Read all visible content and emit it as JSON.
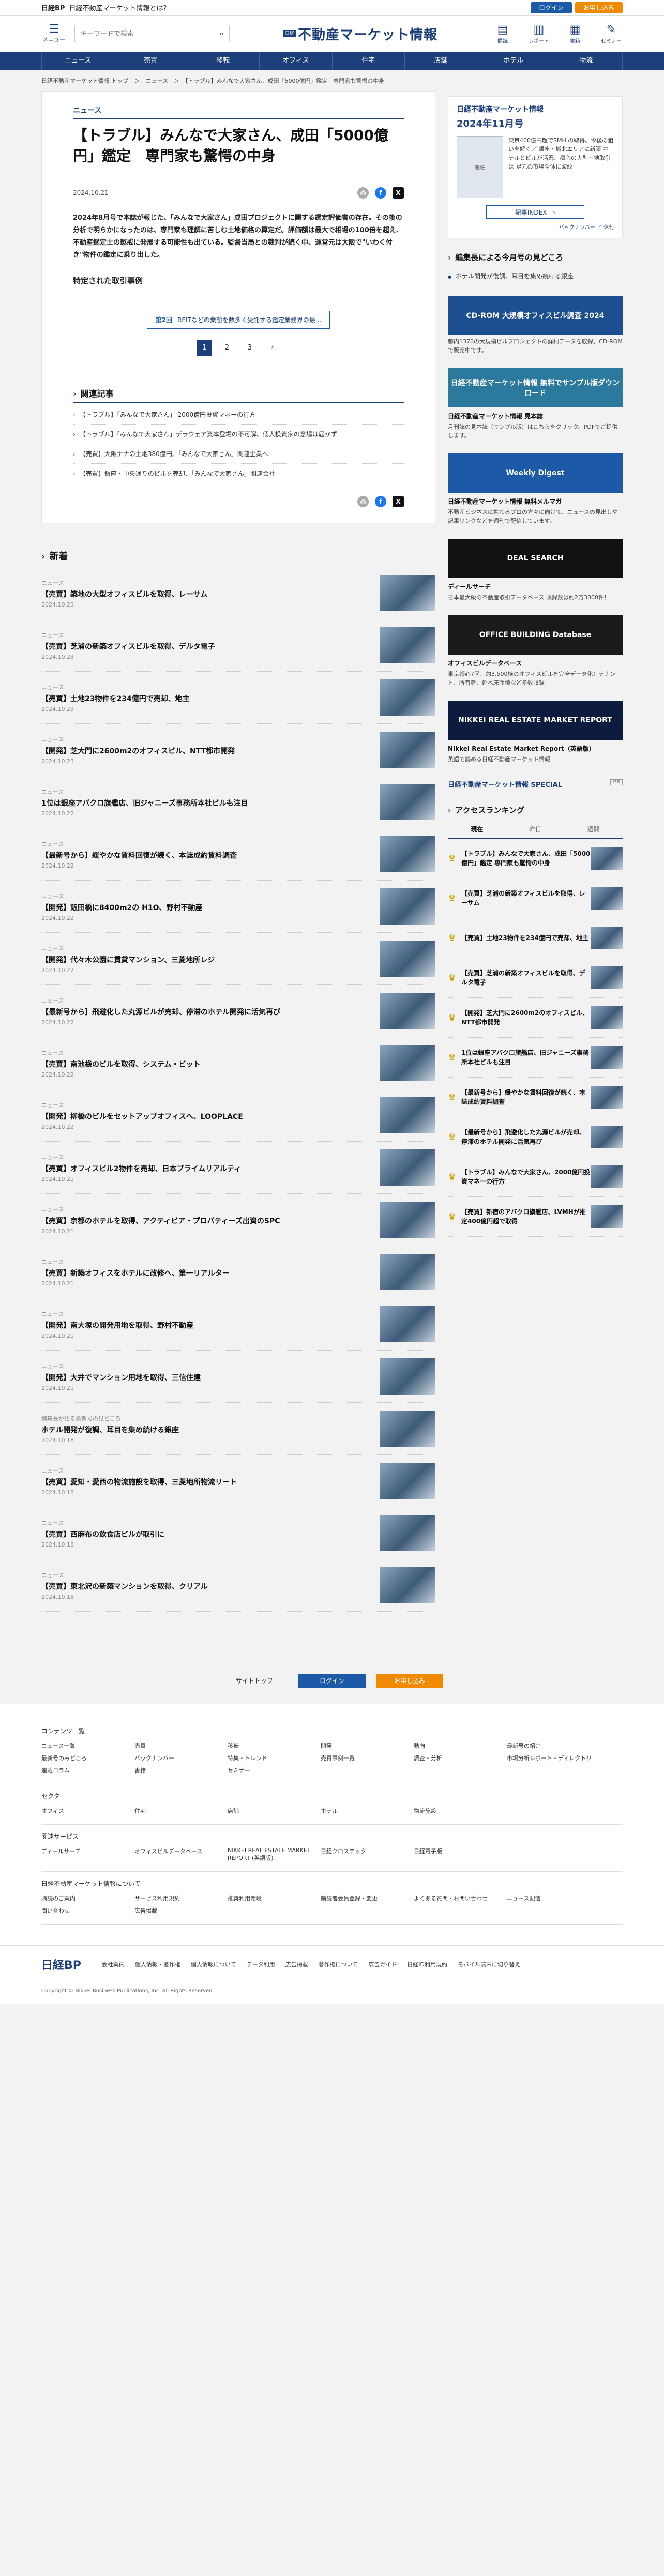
{
  "topbar": {
    "brand": "日経BP",
    "tagline": "日経不動産マーケット情報とは？",
    "login": "ログイン",
    "trial": "お申し込み"
  },
  "header": {
    "menu_label": "メニュー",
    "search_placeholder": "キーワードで検索",
    "logo_nikkei": "日経",
    "logo_title": "不動産マーケット情報",
    "icons": [
      {
        "label": "購読",
        "icon": "book-icon"
      },
      {
        "label": "レポート",
        "icon": "report-icon"
      },
      {
        "label": "書籍",
        "icon": "books-icon"
      },
      {
        "label": "セミナー",
        "icon": "seminar-icon"
      }
    ]
  },
  "nav": [
    "ニュース",
    "売買",
    "移転",
    "オフィス",
    "住宅",
    "店舗",
    "ホテル",
    "物流"
  ],
  "breadcrumb": "日経不動産マーケット情報 トップ　＞　ニュース　＞　【トラブル】みんなで大家さん、成田「5000億円」鑑定　専門家も驚愕の中身",
  "article": {
    "category": "ニュース",
    "title": "【トラブル】みんなで大家さん、成田「5000億円」鑑定　専門家も驚愕の中身",
    "date": "2024.10.21",
    "lead": "2024年8月号で本誌が報じた、「みんなで大家さん」成田プロジェクトに関する鑑定評価書の存在。その後の分析で明らかになったのは、専門家も理解に苦しむ土地価格の算定だ。評価額は最大で相場の100倍を超え、不動産鑑定士の懲戒に発展する可能性も出ている。監督当局との裁判が続く中、運営元は大阪で\"いわく付き\"物件の鑑定に乗り出した。",
    "sub_heading": "特定された取引事例",
    "ad_tag": "第2回",
    "ad_text": "REITなどの業態を数多く受託する鑑定業務界の最...",
    "pages": [
      "1",
      "2",
      "3",
      "›"
    ]
  },
  "related": {
    "heading": "関連記事",
    "items": [
      "【トラブル】「みんなで大家さん」 2000億円投資マネーの行方",
      "【トラブル】「みんなで大家さん」デラウェア資本登場の不可解、個人投資家の意場は届かず",
      "【売買】大阪ナナの土地380億円、「みんなで大家さん」関連企業へ",
      "【売買】銀座・中央通りのビルを売却、「みんなで大家さん」関連会社"
    ]
  },
  "newest": {
    "heading": "新着",
    "items": [
      {
        "cat": "ニュース",
        "title": "【売買】築地の大型オフィスビルを取得、レーサム",
        "date": "2024.10.23"
      },
      {
        "cat": "ニュース",
        "title": "【売買】芝浦の新築オフィスビルを取得、デルタ電子",
        "date": "2024.10.23"
      },
      {
        "cat": "ニュース",
        "title": "【売買】土地23物件を234億円で売却、地主",
        "date": "2024.10.23"
      },
      {
        "cat": "ニュース",
        "title": "【開発】芝大門に2600m2のオフィスビル、NTT都市開発",
        "date": "2024.10.23"
      },
      {
        "cat": "ニュース",
        "title": "1位は銀座アバクロ旗艦店、旧ジャニーズ事務所本社ビルも注目",
        "date": "2024.10.22"
      },
      {
        "cat": "ニュース",
        "title": "【最新号から】緩やかな賃料回復が続く、本誌成約賃料調査",
        "date": "2024.10.22"
      },
      {
        "cat": "ニュース",
        "title": "【開発】飯田橋に8400m2の H1O、野村不動産",
        "date": "2024.10.22"
      },
      {
        "cat": "ニュース",
        "title": "【開発】代々木公園に賃貸マンション、三菱地所レジ",
        "date": "2024.10.22"
      },
      {
        "cat": "ニュース",
        "title": "【最新号から】飛避化した丸源ビルが売却、停滞のホテル開発に活気再び",
        "date": "2024.10.22"
      },
      {
        "cat": "ニュース",
        "title": "【売買】南池袋のビルを取得、システム・ビット",
        "date": "2024.10.22"
      },
      {
        "cat": "ニュース",
        "title": "【開発】柳橋のビルをセットアップオフィスへ、LOOPLACE",
        "date": "2024.10.22"
      },
      {
        "cat": "ニュース",
        "title": "【売買】オフィスビル2物件を売却、日本プライムリアルティ",
        "date": "2024.10.21"
      },
      {
        "cat": "ニュース",
        "title": "【売買】京都のホテルを取得、アクティビア・プロパティーズ出資のSPC",
        "date": "2024.10.21"
      },
      {
        "cat": "ニュース",
        "title": "【売買】新築オフィスをホテルに改修へ、第一リアルター",
        "date": "2024.10.21"
      },
      {
        "cat": "ニュース",
        "title": "【開発】南大塚の開発用地を取得、野村不動産",
        "date": "2024.10.21"
      },
      {
        "cat": "ニュース",
        "title": "【開発】大井でマンション用地を取得、三信住建",
        "date": "2024.10.21"
      },
      {
        "cat": "編集長が語る最新号の見どころ",
        "title": "ホテル開発が復調、耳目を集め続ける銀座",
        "date": "2024.10.18"
      },
      {
        "cat": "ニュース",
        "title": "【売買】愛知・愛西の物流施設を取得、三菱地所物流リート",
        "date": "2024.10.18"
      },
      {
        "cat": "ニュース",
        "title": "【売買】西麻布の飲食店ビルが取引に",
        "date": "2024.10.18"
      },
      {
        "cat": "ニュース",
        "title": "【売買】東北沢の新築マンションを取得、クリアル",
        "date": "2024.10.18"
      }
    ]
  },
  "sidebar": {
    "mag_head": "日経不動産マーケット情報",
    "mag_month": "2024年11月号",
    "mag_cover": "表紙",
    "mag_text": "東京400億円超でSMH の取得、今後の狙いを解く／ 銀座・城北エリアに新築 ホテルとビルが活況、都心の大型土地取引は 足元の市場全体に波紋",
    "index_btn": "記事INDEX　›",
    "back_link": "バックナンバー ／ 休刊",
    "editor_heading": "編集長による今月号の見どころ",
    "editor_items": [
      "ホテル開発が復調、耳目を集め続ける銀座"
    ],
    "banners": [
      {
        "img": "CD-ROM 大規模オフィスビル調査 2024",
        "title": "",
        "desc": "都内1370の大規模ビルプロジェクトの詳細データを収録。CD-ROMで販売中です。"
      },
      {
        "img": "日経不動産マーケット情報 無料でサンプル版ダウンロード",
        "title": "日経不動産マーケット情報 見本誌",
        "desc": "月刊誌の見本誌（サンプル版）はこちらをクリック。PDFでご提供します。"
      },
      {
        "img": "Weekly Digest",
        "title": "日経不動産マーケット情報 無料メルマガ",
        "desc": "不動産ビジネスに携わるプロの方々に向けて、ニュースの見出しや記事リンクなどを週刊で配信しています。"
      },
      {
        "img": "DEAL SEARCH",
        "title": "ディールサーチ",
        "desc": "日本最大級の不動産取引データベース 収録数は約2万3000件！"
      },
      {
        "img": "OFFICE BUILDING Database",
        "title": "オフィスビルデータベース",
        "desc": "東京都心7区、約3,500棟のオフィスビルを完全データ化！テナント、所有者、延べ床面積など多数収録"
      },
      {
        "img": "NIKKEI REAL ESTATE MARKET REPORT",
        "title": "Nikkei Real Estate Market Report（英語版）",
        "desc": "英語で読める日経不動産マーケット情報"
      }
    ],
    "special": "日経不動産マーケット情報 SPECIAL",
    "special_pr": "PR",
    "rank_heading": "アクセスランキング",
    "rank_tabs": [
      "現在",
      "昨日",
      "週間"
    ],
    "ranks": [
      "【トラブル】みんなで大家さん、成田「5000億円」鑑定 専門家も驚愕の中身",
      "【売買】芝浦の新築オフィスビルを取得、レーサム",
      "【売買】土地23物件を234億円で売却、地主",
      "【売買】芝浦の新築オフィスビルを取得、デルタ電子",
      "【開発】芝大門に2600m2のオフィスビル、NTT都市開発",
      "1位は銀座アバクロ旗艦店、旧ジャニーズ事務所本社ビルも注目",
      "【最新号から】緩やかな賃料回復が続く、本誌成約賃料調査",
      "【最新号から】飛避化した丸源ビルが売却、停滞のホテル開発に活気再び",
      "【トラブル】みんなで大家さん、2000億円投資マネーの行方",
      "【売買】新宿のアバクロ旗艦店、LVMHが推定400億円超で取得"
    ]
  },
  "footer": {
    "buttons": [
      "サイトトップ",
      "ログイン",
      "お申し込み"
    ],
    "content_head": "コンテンツ一覧",
    "content_links": [
      "ニュース一覧",
      "売買",
      "移転",
      "開発",
      "動向",
      "最新号の紹介",
      "最新号のみどころ",
      "バックナンバー",
      "特集・トレンド",
      "売買事例一覧",
      "調査・分析",
      "市場分析レポート・ディレクトリ",
      "連載コラム",
      "書籍",
      "セミナー"
    ],
    "sector_head": "セクター",
    "sector_links": [
      "オフィス",
      "住宅",
      "店舗",
      "ホテル",
      "物流施設"
    ],
    "related_head": "関連サービス",
    "related_links": [
      "ディールサーチ",
      "オフィスビルデータベース",
      "NIKKEI REAL ESTATE MARKET REPORT (英語版)",
      "日経クロステック",
      "日経電子版"
    ],
    "guide_head": "日経不動産マーケット情報について",
    "guide_links": [
      "購読のご案内",
      "サービス利用規約",
      "推奨利用環境",
      "購読者会員登録・変更",
      "よくある質問・お問い合わせ",
      "ニュース配信",
      "問い合わせ",
      "広告掲載"
    ],
    "logo": "日経BP",
    "bottom_links": [
      "会社案内",
      "個人情報・著作権",
      "個人情報について",
      "データ利用",
      "広告掲載",
      "著作権について",
      "広告ガイド",
      "日経ID利用規約",
      "モバイル端末に切り替え"
    ],
    "copyright": "Copyright © Nikkei Business Publications, Inc. All Rights Reserved."
  }
}
